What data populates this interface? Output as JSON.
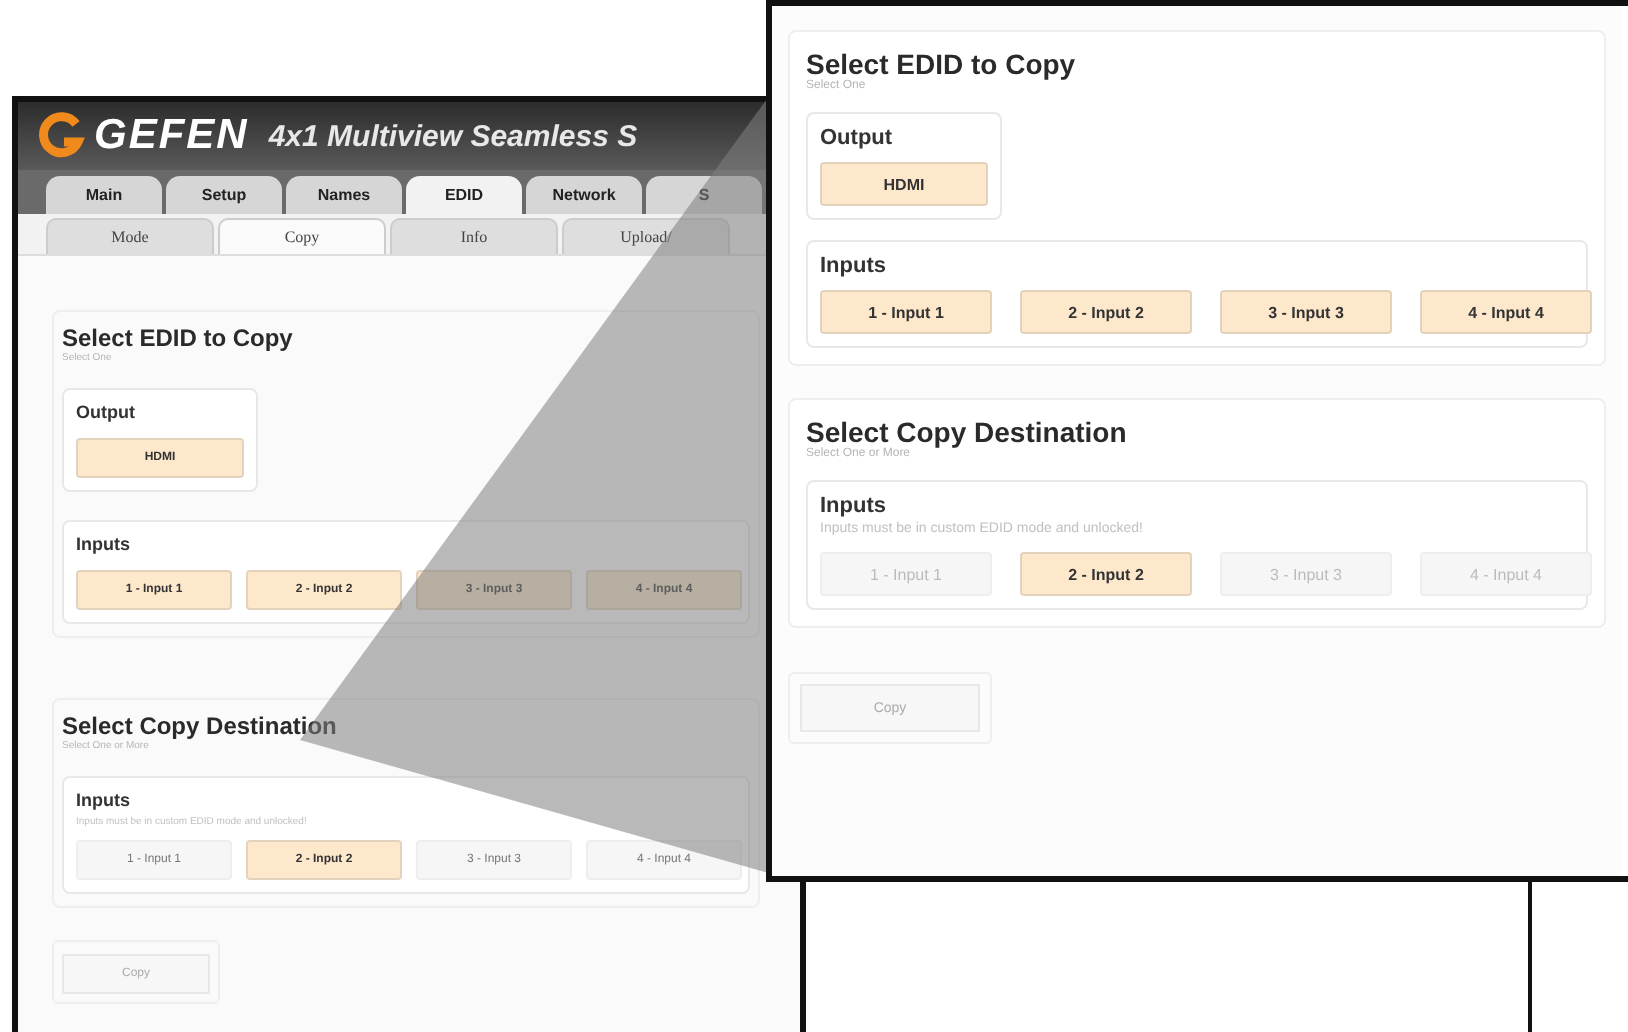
{
  "screenshot": {
    "logo": "GEFEN",
    "title": "4x1 Multiview Seamless S",
    "tabs": [
      {
        "label": "Main",
        "selected": false
      },
      {
        "label": "Setup",
        "selected": false
      },
      {
        "label": "Names",
        "selected": false
      },
      {
        "label": "EDID",
        "selected": true
      },
      {
        "label": "Network",
        "selected": false
      },
      {
        "label": "S",
        "selected": false
      }
    ],
    "subtabs": [
      {
        "label": "Mode",
        "selected": false
      },
      {
        "label": "Copy",
        "selected": true
      },
      {
        "label": "Info",
        "selected": false
      },
      {
        "label": "Upload/",
        "selected": false
      }
    ],
    "panel": {
      "edid": {
        "title": "Select EDID to Copy",
        "subtitle": "Select One",
        "output": {
          "label": "Output",
          "buttons": [
            "HDMI"
          ]
        },
        "inputs": {
          "label": "Inputs",
          "buttons": [
            "1 - Input 1",
            "2 - Input 2",
            "3 - Input 3",
            "4 - Input 4"
          ]
        }
      },
      "destination": {
        "title": "Select Copy Destination",
        "subtitle": "Select One or More",
        "inputs": {
          "label": "Inputs",
          "note": "Inputs must be in custom EDID mode and unlocked!",
          "buttons": [
            {
              "label": "1 - Input 1",
              "selected": false
            },
            {
              "label": "2 - Input 2",
              "selected": true
            },
            {
              "label": "3 - Input 3",
              "selected": false
            },
            {
              "label": "4 - Input 4",
              "selected": false
            }
          ]
        }
      },
      "copy_button": "Copy"
    }
  },
  "zoomed_view": {
    "panel": {
      "edid": {
        "title": "Select EDID to Copy",
        "subtitle": "Select One",
        "output": {
          "label": "Output",
          "buttons": [
            "HDMI"
          ]
        },
        "inputs": {
          "label": "Inputs",
          "buttons": [
            "1 - Input 1",
            "2 - Input 2",
            "3 - Input 3",
            "4 - Input 4"
          ]
        }
      },
      "destination": {
        "title": "Select Copy Destination",
        "subtitle": "Select One or More",
        "inputs": {
          "label": "Inputs",
          "note": "Inputs must be in custom EDID mode and unlocked!",
          "buttons": [
            {
              "label": "1 - Input 1",
              "selected": false
            },
            {
              "label": "2 - Input 2",
              "selected": true
            },
            {
              "label": "3 - Input 3",
              "selected": false
            },
            {
              "label": "4 - Input 4",
              "selected": false
            }
          ]
        }
      },
      "copy_button": "Copy"
    }
  }
}
